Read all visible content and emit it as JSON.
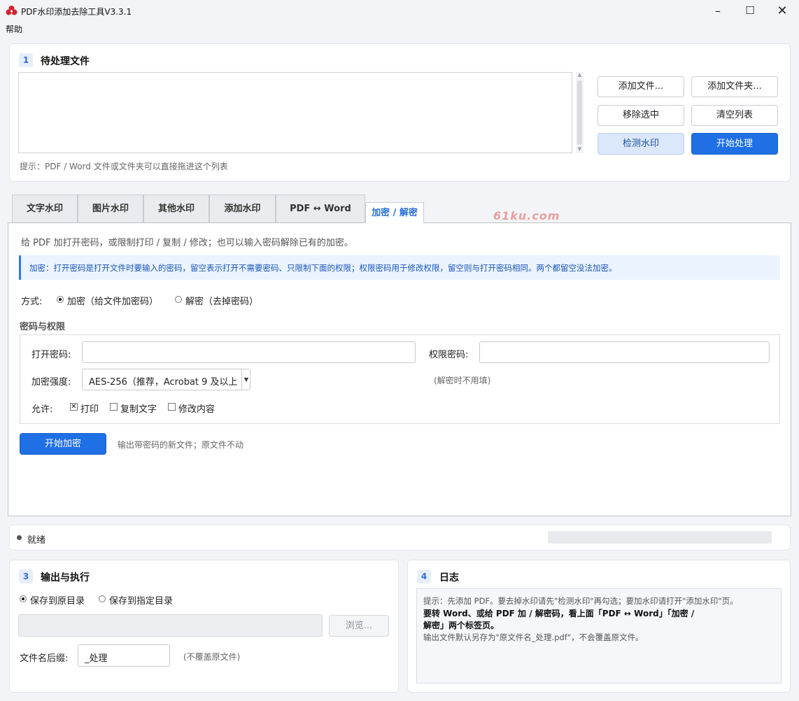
{
  "window": {
    "title": "PDF水印添加去除工具V3.3.1",
    "minimize": "–",
    "maximize": "☐",
    "close": "✕"
  },
  "menu": {
    "help": "帮助"
  },
  "section1": {
    "number": "1",
    "title": "待处理文件",
    "hint": "提示：PDF / Word 文件或文件夹可以直接拖进这个列表",
    "buttons": {
      "add_files": "添加文件...",
      "add_folder": "添加文件夹...",
      "remove_selected": "移除选中",
      "clear_list": "清空列表",
      "detect_watermark": "检测水印",
      "start": "开始处理"
    }
  },
  "tabs": [
    "文字水印",
    "图片水印",
    "其他水印",
    "添加水印",
    "PDF ↔ Word",
    "加密 / 解密"
  ],
  "watermark_text": "61ku.com",
  "encrypt": {
    "description": "给 PDF 加打开密码，或限制打印 / 复制 / 修改；也可以输入密码解除已有的加密。",
    "info": "加密：打开密码是打开文件时要输入的密码，留空表示打开不需要密码、只限制下面的权限；权限密码用于修改权限，留空则与打开密码相同。两个都留空没法加密。",
    "mode_label": "方式:",
    "mode_encrypt": "加密（给文件加密码）",
    "mode_decrypt": "解密（去掉密码）",
    "group_title": "密码与权限",
    "open_pwd_label": "打开密码:",
    "perm_pwd_label": "权限密码:",
    "strength_label": "加密强度:",
    "strength_value": "AES-256（推荐，Acrobat 9 及以上",
    "decrypt_note": "(解密时不用填)",
    "allow_label": "允许:",
    "allow_print": "打印",
    "allow_copy": "复制文字",
    "allow_modify": "修改内容",
    "start_button": "开始加密",
    "start_note": "输出带密码的新文件；原文件不动"
  },
  "status": {
    "text": "就绪"
  },
  "section3": {
    "number": "3",
    "title": "输出与执行",
    "save_original": "保存到原目录",
    "save_custom": "保存到指定目录",
    "browse": "浏览...",
    "suffix_label": "文件名后缀:",
    "suffix_value": "_处理",
    "suffix_note": "(不覆盖原文件)"
  },
  "section4": {
    "number": "4",
    "title": "日志",
    "line1": "提示：先添加 PDF。要去掉水印请先\"检测水印\"再勾选；要加水印请打开\"添加水印\"页。",
    "line2": "要转 Word、或给 PDF 加 / 解密码，看上面「PDF ↔ Word」「加密 /",
    "line3": "解密」两个标签页。",
    "line4": "输出文件默认另存为\"原文件名_处理.pdf\"，不会覆盖原文件。"
  },
  "colors": {
    "accent": "#1f6fe5",
    "watermark": "#e8a0a0"
  }
}
